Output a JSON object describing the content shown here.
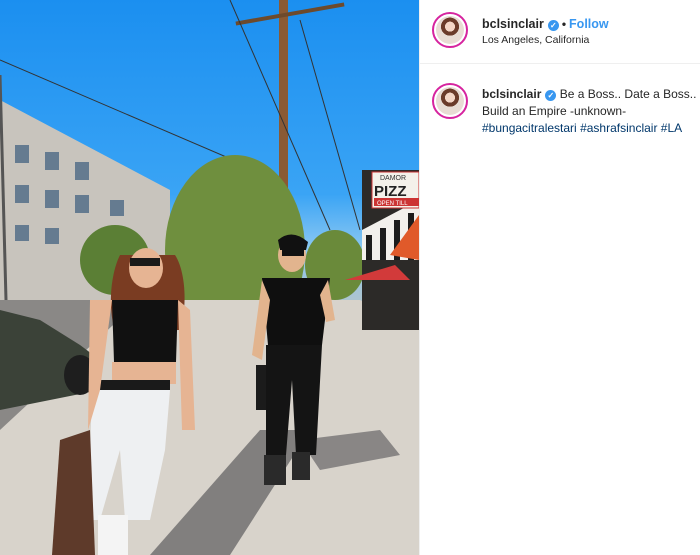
{
  "post": {
    "username": "bclsinclair",
    "follow_label": "Follow",
    "separator": "•",
    "location": "Los Angeles, California",
    "verified_glyph": "✓"
  },
  "caption": {
    "username": "bclsinclair",
    "line1": "Be a Boss.. Date a Boss..",
    "line2": "Build an Empire -unknown-",
    "hashtags": [
      "#bungacitralestari",
      "#ashrafsinclair",
      "#LA"
    ]
  },
  "photo": {
    "sign_text_top": "DAMOR",
    "sign_text_main": "PIZZ",
    "sign_text_bottom": "OPEN TILL"
  },
  "colors": {
    "accent_blue": "#3897f0",
    "hashtag": "#00376b",
    "avatar_ring": "#d6249f"
  }
}
